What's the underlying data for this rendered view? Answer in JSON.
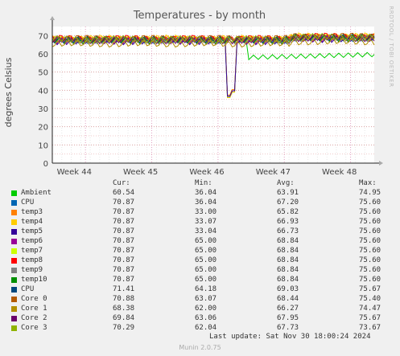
{
  "chart_data": {
    "type": "line",
    "title": "Temperatures - by month",
    "ylabel": "degrees Celsius",
    "side_text": "RRDTOOL / TOBI OETIKER",
    "ylim": [
      0,
      75
    ],
    "yticks": [
      0,
      10,
      20,
      30,
      40,
      50,
      60,
      70
    ],
    "xlim": [
      0,
      34
    ],
    "xticks": [
      {
        "label": "Week 44",
        "x": 3
      },
      {
        "label": "Week 45",
        "x": 10
      },
      {
        "label": "Week 46",
        "x": 17
      },
      {
        "label": "Week 47",
        "x": 24
      },
      {
        "label": "Week 48",
        "x": 31
      }
    ],
    "grid": true,
    "series": [
      {
        "name": "Ambient",
        "color": "#00cc00",
        "cur": "60.54",
        "min": "36.04",
        "avg": "63.91",
        "max": "74.95"
      },
      {
        "name": "CPU",
        "color": "#0066b3",
        "cur": "70.87",
        "min": "36.04",
        "avg": "67.20",
        "max": "75.60"
      },
      {
        "name": "temp3",
        "color": "#ff8000",
        "cur": "70.87",
        "min": "33.00",
        "avg": "65.82",
        "max": "75.60"
      },
      {
        "name": "temp4",
        "color": "#ffcc00",
        "cur": "70.87",
        "min": "33.07",
        "avg": "66.93",
        "max": "75.60"
      },
      {
        "name": "temp5",
        "color": "#330099",
        "cur": "70.87",
        "min": "33.04",
        "avg": "66.73",
        "max": "75.60"
      },
      {
        "name": "temp6",
        "color": "#990099",
        "cur": "70.87",
        "min": "65.00",
        "avg": "68.84",
        "max": "75.60"
      },
      {
        "name": "temp7",
        "color": "#ccff00",
        "cur": "70.87",
        "min": "65.00",
        "avg": "68.84",
        "max": "75.60"
      },
      {
        "name": "temp8",
        "color": "#ff0000",
        "cur": "70.87",
        "min": "65.00",
        "avg": "68.84",
        "max": "75.60"
      },
      {
        "name": "temp9",
        "color": "#808080",
        "cur": "70.87",
        "min": "65.00",
        "avg": "68.84",
        "max": "75.60"
      },
      {
        "name": "temp10",
        "color": "#008f00",
        "cur": "70.87",
        "min": "65.00",
        "avg": "68.84",
        "max": "75.60"
      },
      {
        "name": "CPU",
        "color": "#00487d",
        "cur": "71.41",
        "min": "64.18",
        "avg": "69.03",
        "max": "75.67"
      },
      {
        "name": "Core 0",
        "color": "#b35a00",
        "cur": "70.88",
        "min": "63.07",
        "avg": "68.44",
        "max": "75.40"
      },
      {
        "name": "Core 1",
        "color": "#b38f00",
        "cur": "68.38",
        "min": "62.00",
        "avg": "66.27",
        "max": "74.47"
      },
      {
        "name": "Core 2",
        "color": "#6b006b",
        "cur": "69.84",
        "min": "63.06",
        "avg": "67.95",
        "max": "75.67"
      },
      {
        "name": "Core 3",
        "color": "#8fb300",
        "cur": "70.29",
        "min": "62.04",
        "avg": "67.73",
        "max": "73.67"
      }
    ]
  },
  "legend_headers": {
    "cur": "Cur:",
    "min": "Min:",
    "avg": "Avg:",
    "max": "Max:"
  },
  "last_update": "Last update: Sat Nov 30 18:00:24 2024",
  "munin_version": "Munin 2.0.75"
}
